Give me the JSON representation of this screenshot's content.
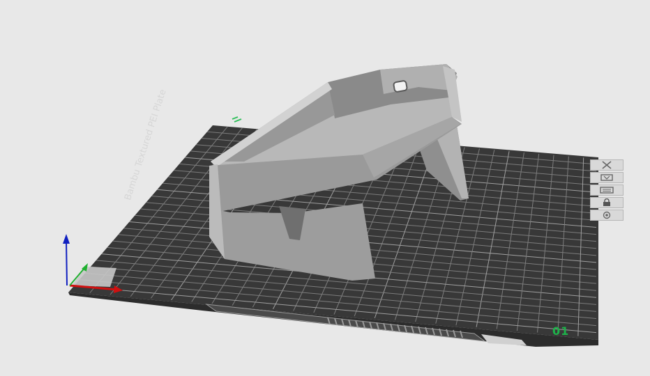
{
  "plate": {
    "name": "Bambu Textured PEI Plate",
    "index": "01"
  },
  "plate_tools": [
    {
      "name": "close-icon",
      "label": "Delete plate"
    },
    {
      "name": "orient-icon",
      "label": "Auto orient"
    },
    {
      "name": "arrange-icon",
      "label": "Arrange"
    },
    {
      "name": "lock-icon",
      "label": "Lock plate"
    },
    {
      "name": "settings-icon",
      "label": "Plate settings"
    }
  ],
  "colors": {
    "background": "#e8e8e8",
    "plate": "#3a3a3a",
    "grid": "#7a7a7a",
    "model": "#a9a9a9",
    "axis_x": "#d01010",
    "axis_y": "#20b030",
    "axis_z": "#1020c0",
    "plate_index": "#1db34a"
  }
}
